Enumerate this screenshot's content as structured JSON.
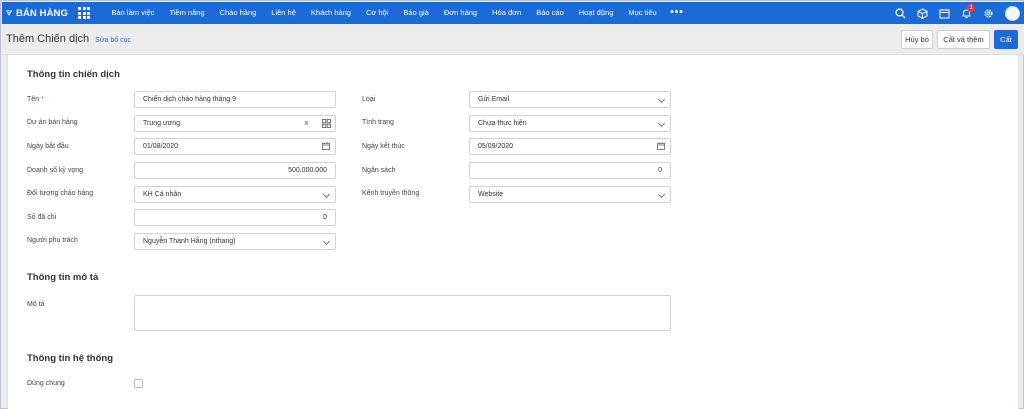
{
  "brand": {
    "title": "BÁN HÀNG",
    "color": "#1c6ad6"
  },
  "nav": {
    "items": [
      "Bàn làm việc",
      "Tiềm năng",
      "Chào hàng",
      "Liên hệ",
      "Khách hàng",
      "Cơ hội",
      "Báo giá",
      "Đơn hàng",
      "Hóa đơn",
      "Báo cáo",
      "Hoạt động",
      "Mục tiêu"
    ],
    "more": "•••"
  },
  "top_icons": [
    "search-icon",
    "package-icon",
    "calendar-icon",
    "bell-icon",
    "gear-icon",
    "avatar"
  ],
  "notifications": {
    "count": "1"
  },
  "header": {
    "title": "Thêm Chiến dịch",
    "edit_layout": "Sửa bố cục"
  },
  "actions": {
    "cancel": "Hủy bỏ",
    "save_and_add": "Cất và thêm",
    "save": "Cất"
  },
  "sections": {
    "info": "Thông tin chiến dịch",
    "description": "Thông tin mô tả",
    "system": "Thông tin hệ thống"
  },
  "form": {
    "name": {
      "label": "Tên",
      "required_mark": "*",
      "value": "Chiến dịch chào hàng tháng 9"
    },
    "project": {
      "label": "Dự án bán hàng",
      "value": "Trung ương",
      "clear": "×"
    },
    "start_date": {
      "label": "Ngày bắt đầu",
      "value": "01/08/2020"
    },
    "expected_sales": {
      "label": "Doanh số kỳ vọng",
      "value": "500.000.000"
    },
    "target": {
      "label": "Đối tượng chào hàng",
      "value": "KH Cá nhân"
    },
    "spent": {
      "label": "Số đã chi",
      "value": "0"
    },
    "owner": {
      "label": "Người phụ trách",
      "value": "Nguyễn Thanh Hằng (nthang)"
    },
    "type": {
      "label": "Loại",
      "value": "Gửi Email"
    },
    "status": {
      "label": "Tình trạng",
      "value": "Chưa thực hiện"
    },
    "end_date": {
      "label": "Ngày kết thúc",
      "value": "05/09/2020"
    },
    "budget": {
      "label": "Ngân sách",
      "value": "0"
    },
    "channel": {
      "label": "Kênh truyền thông",
      "value": "Website"
    },
    "description": {
      "label": "Mô tả",
      "value": ""
    },
    "shared": {
      "label": "Dùng chung",
      "checked": false
    }
  }
}
